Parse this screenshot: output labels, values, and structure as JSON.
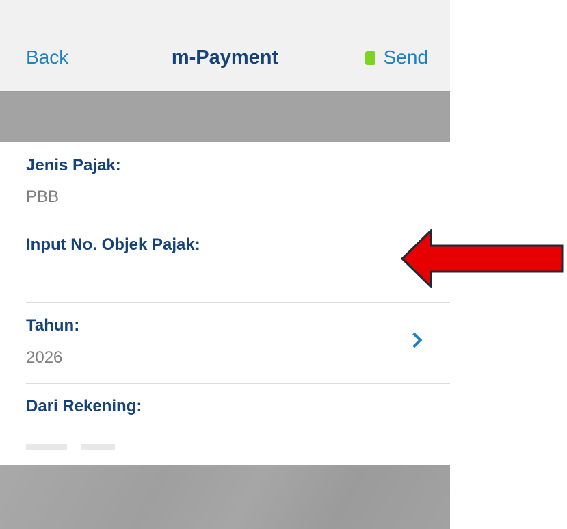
{
  "header": {
    "back_label": "Back",
    "title": "m-Payment",
    "send_label": "Send"
  },
  "form": {
    "fields": [
      {
        "label": "Jenis Pajak:",
        "value": "PBB"
      },
      {
        "label": "Input No. Objek Pajak:",
        "value": ""
      },
      {
        "label": "Tahun:",
        "value": "2026"
      },
      {
        "label": "Dari Rekening:",
        "value": ""
      }
    ]
  },
  "icons": {
    "send_indicator": "green-square-icon",
    "tahun_chevron": "chevron-right-icon",
    "annotation": "red-arrow-left-icon"
  },
  "colors": {
    "accent_blue": "#1d82c4",
    "label_navy": "#16427a",
    "send_green": "#7ed321",
    "arrow_red": "#e60000"
  }
}
